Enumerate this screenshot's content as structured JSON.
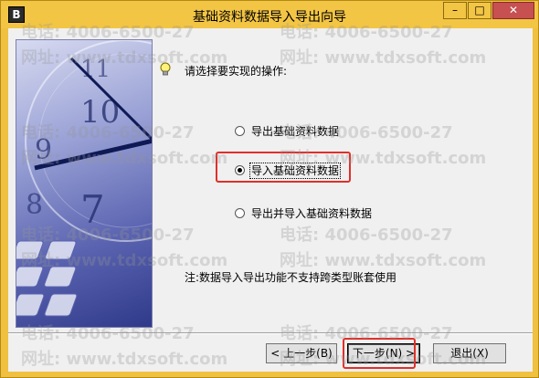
{
  "window": {
    "title": "基础资料数据导入导出向导",
    "app_icon_glyph": "B",
    "controls": {
      "minimize": "–",
      "maximize": "□",
      "close": "✕"
    }
  },
  "wizard": {
    "prompt": "请选择要实现的操作:",
    "options": [
      {
        "label": "导出基础资料数据",
        "checked": false
      },
      {
        "label": "导入基础资料数据",
        "checked": true
      },
      {
        "label": "导出并导入基础资料数据",
        "checked": false
      }
    ],
    "note": "注:数据导入导出功能不支持跨类型账套使用"
  },
  "buttons": {
    "prev": "< 上一步(B)",
    "next": "下一步(N) >",
    "exit": "退出(X)"
  },
  "watermark": {
    "phone": "电话: 4006-6500-27",
    "site": "网址: www.tdxsoft.com"
  },
  "colors": {
    "titlebar": "#f3c544",
    "highlight": "#e0302a",
    "dialog_bg": "#f0f0f0"
  }
}
